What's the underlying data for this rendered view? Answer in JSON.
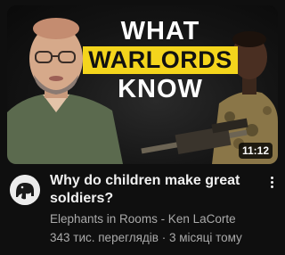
{
  "thumbnail": {
    "caption_line1": "WHAT",
    "caption_line2": "WARLORDS",
    "caption_line3": "KNOW",
    "duration": "11:12",
    "accent_color": "#f4d51c"
  },
  "video": {
    "title": "Why do children make great soldiers?",
    "channel": "Elephants in Rooms - Ken LaCorte",
    "views": "343 тис. переглядів",
    "separator": "·",
    "age": "3 місяці тому"
  },
  "icons": {
    "channel_avatar": "elephant-logo-icon",
    "menu": "more-vert-icon"
  }
}
